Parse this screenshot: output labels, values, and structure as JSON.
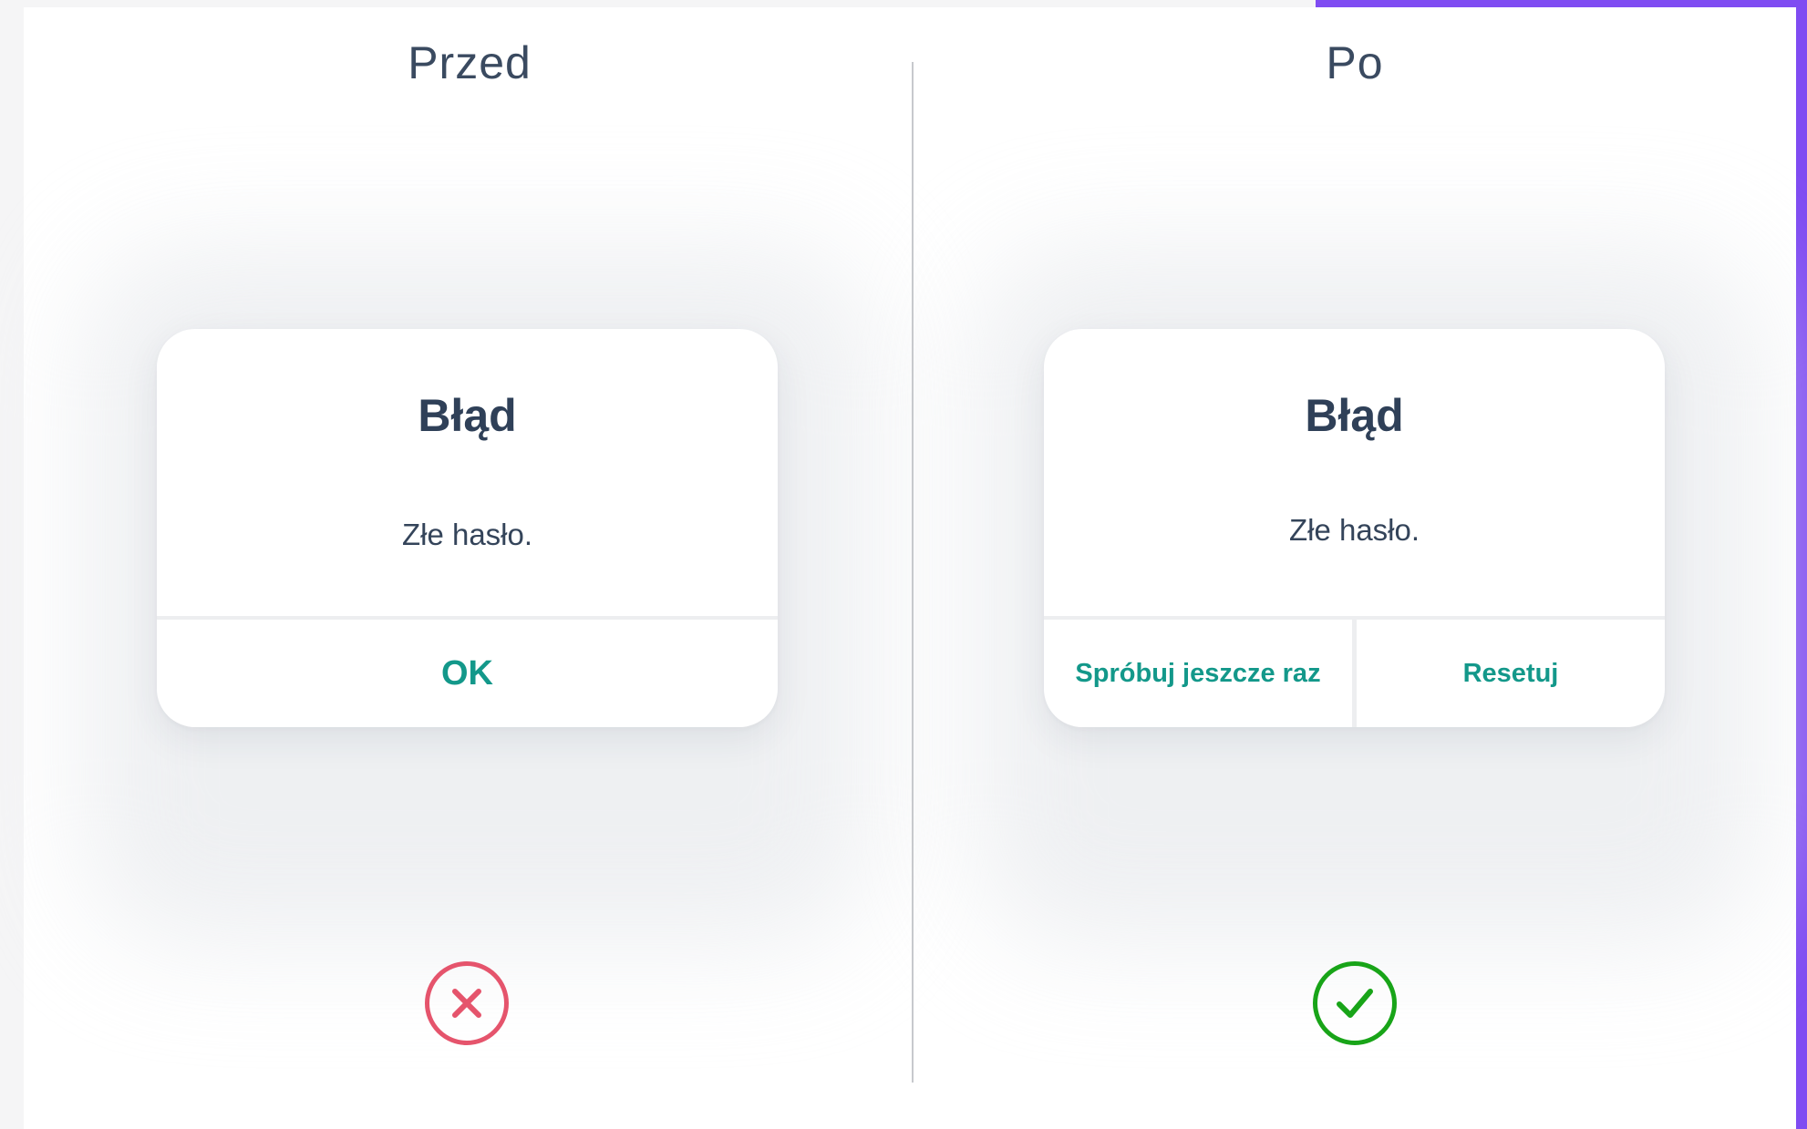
{
  "before": {
    "heading": "Przed",
    "dialog": {
      "title": "Błąd",
      "message": "Złe hasło.",
      "ok_label": "OK"
    },
    "verdict_icon": "close-circle-icon",
    "verdict_color": "#e5546c"
  },
  "after": {
    "heading": "Po",
    "dialog": {
      "title": "Błąd",
      "message": "Złe hasło.",
      "retry_label": "Spróbuj jeszcze raz",
      "reset_label": "Resetuj"
    },
    "verdict_icon": "check-circle-icon",
    "verdict_color": "#18a418"
  },
  "colors": {
    "accent": "#7f4cf2",
    "action_text": "#13988a",
    "heading_text": "#2f4058"
  }
}
